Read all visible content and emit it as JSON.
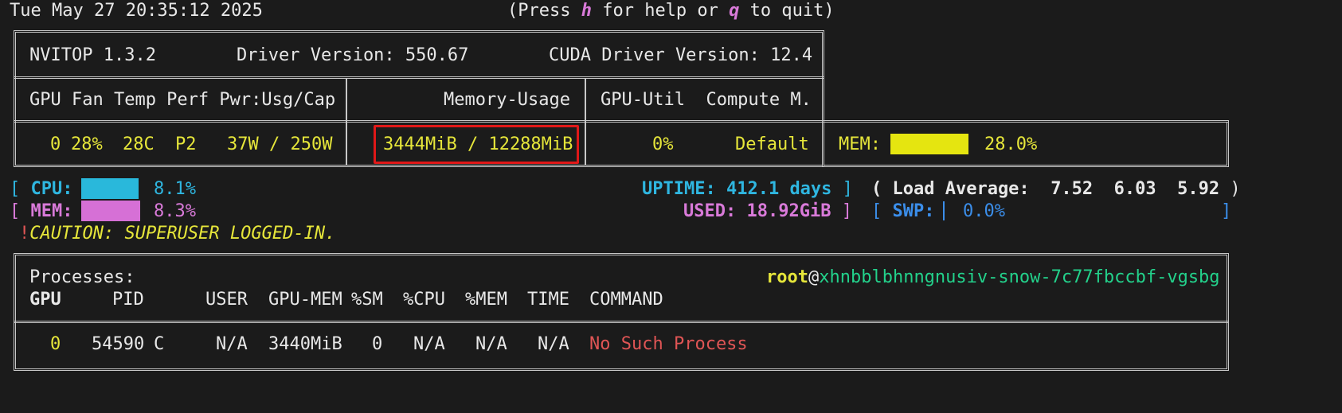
{
  "header": {
    "datetime": "Tue May 27 20:35:12 2025",
    "help_prefix": "(Press ",
    "help_key": "h",
    "help_mid": " for help or ",
    "quit_key": "q",
    "help_suffix": " to quit)"
  },
  "gpu_table": {
    "nvitop_version": "NVITOP 1.3.2",
    "driver_version": "Driver Version: 550.67",
    "cuda_version": "CUDA Driver Version: 12.4",
    "col_header_left": "GPU Fan Temp Perf Pwr:Usg/Cap",
    "col_header_mid": "Memory-Usage",
    "col_header_right": "GPU-Util  Compute M.",
    "row": {
      "gpu": "0",
      "fan": "28%",
      "temp": "28C",
      "perf": "P2",
      "power": "37W / 250W",
      "memory": "3444MiB / 12288MiB",
      "util": "0%",
      "compute_mode": "Default",
      "mem_label": "MEM:",
      "mem_percent": "28.0%",
      "mem_fraction": 0.28
    }
  },
  "host": {
    "cpu_label": "CPU:",
    "cpu_percent": "8.1%",
    "cpu_fraction": 0.081,
    "mem_label": "MEM:",
    "mem_percent": "8.3%",
    "mem_fraction": 0.083,
    "uptime_label": "UPTIME:",
    "uptime_value": "412.1 days",
    "load_label": "( Load Average:",
    "load_values": "7.52  6.03  5.92",
    "used_label": "USED:",
    "used_value": "18.92GiB",
    "swp_label": "SWP:",
    "swp_percent": "0.0%",
    "caution_mark": "!",
    "caution_text": "CAUTION: SUPERUSER LOGGED-IN."
  },
  "processes": {
    "title": "Processes:",
    "user": "root",
    "at": "@",
    "hostname": "xhnbblbhnngnusiv-snow-7c77fbccbf-vgsbg",
    "columns": [
      "GPU",
      "PID",
      "USER",
      "GPU-MEM",
      "%SM",
      "%CPU",
      "%MEM",
      "TIME",
      "COMMAND"
    ],
    "rows": [
      {
        "gpu": "0",
        "pid": "54590",
        "type": "C",
        "user": "N/A",
        "gpu_mem": "3440MiB",
        "sm": "0",
        "cpu": "N/A",
        "mem": "N/A",
        "time": "N/A",
        "command": "No Such Process"
      }
    ]
  },
  "colors": {
    "background": "#1b1b1b",
    "highlight_border": "#e01818",
    "cpu_bar": "#29b8db",
    "mem_bar": "#d670d6",
    "gpu_mem_bar": "#e5e510"
  }
}
